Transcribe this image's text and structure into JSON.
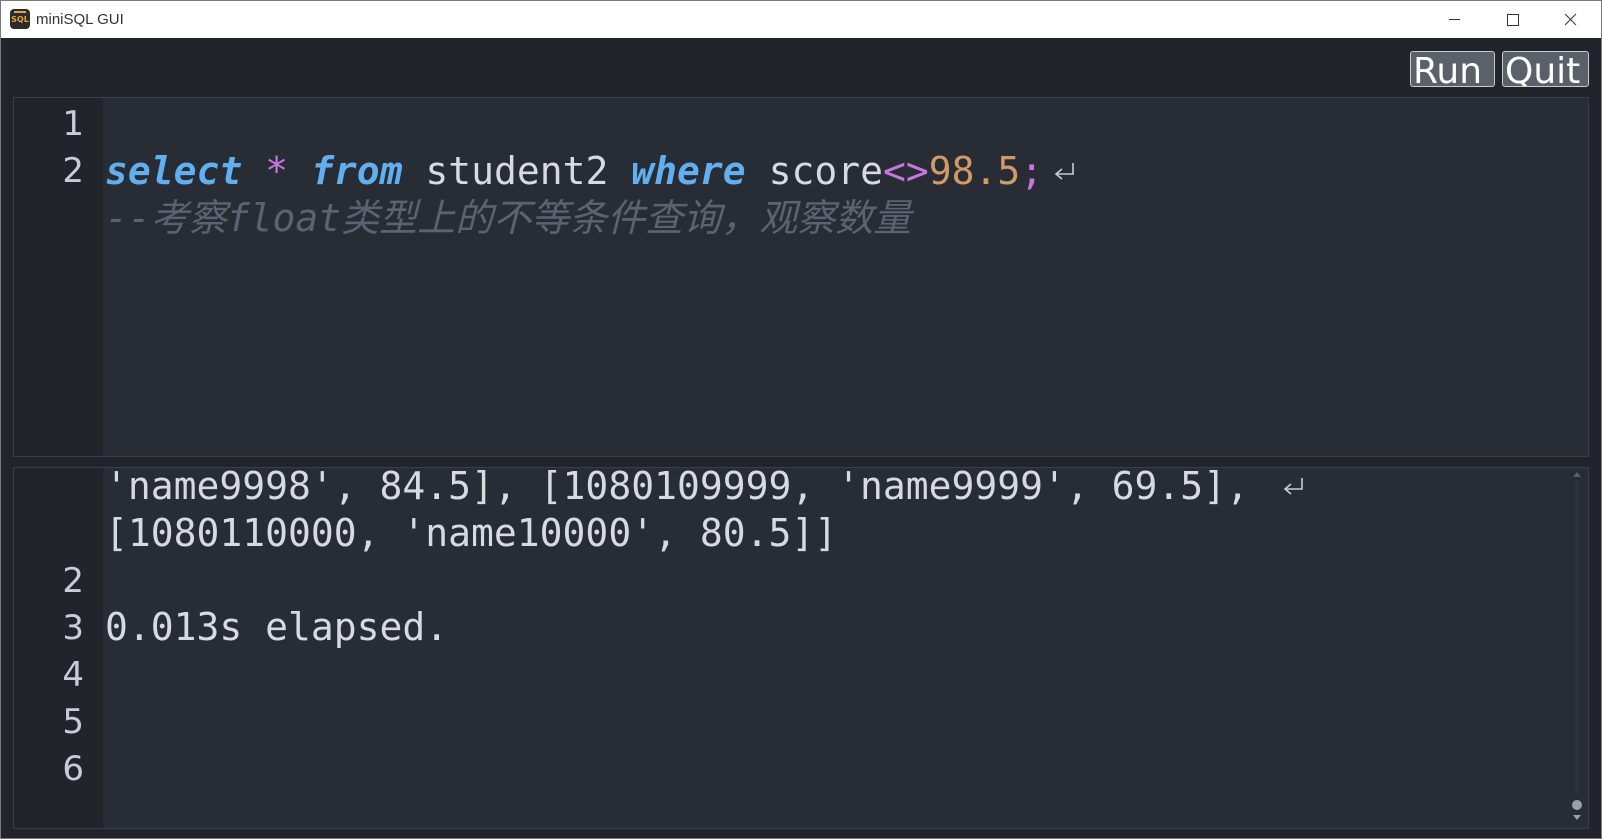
{
  "window": {
    "title": "miniSQL GUI",
    "icon_label": "SQL"
  },
  "toolbar": {
    "run_label": "Run",
    "quit_label": "Quit"
  },
  "editor": {
    "line_numbers": [
      "1",
      "2"
    ],
    "keyword_select": "select",
    "star": "*",
    "keyword_from": "from",
    "table": "student2",
    "keyword_where": "where",
    "column": "score",
    "operator": "<>",
    "value": "98.5",
    "terminator": ";",
    "comment": "--考察float类型上的不等条件查询，观察数量"
  },
  "output": {
    "line_numbers": [
      "2",
      "3",
      "4",
      "5",
      "6"
    ],
    "wrapped_line_1": "'name9998', 84.5], [1080109999, 'name9999', 69.5], ",
    "wrapped_line_2": "[1080110000, 'name10000', 80.5]]",
    "elapsed": "0.013s elapsed."
  },
  "colors": {
    "background": "#282c34",
    "gutter": "#21252b",
    "keyword": "#61afef",
    "operator": "#c678dd",
    "number": "#d19a66",
    "comment": "#5c6370",
    "text": "#d7dae0"
  },
  "icons": {
    "minimize": "minimize-icon",
    "maximize": "maximize-icon",
    "close": "close-icon",
    "wrap": "line-wrap-icon"
  }
}
